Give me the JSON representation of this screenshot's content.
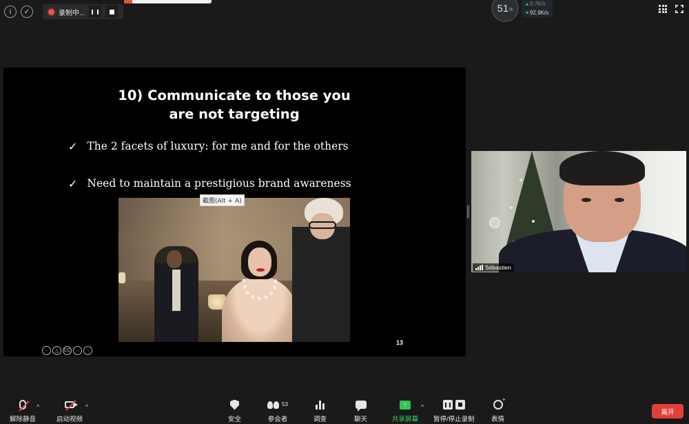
{
  "topbar": {
    "info_icon": "info-icon",
    "security_icon": "shield-check-icon",
    "recording_label": "录制中...",
    "network": {
      "percent": "51",
      "percent_unit": "%",
      "upload": "0.7K/s",
      "download": "92.9K/s"
    }
  },
  "slide": {
    "title_line1": "10) Communicate to those you",
    "title_line2": "are not targeting",
    "bullets": [
      "The 2 facets of luxury: for me and for the others",
      "Need to maintain a prestigious brand awareness"
    ],
    "check_glyph": "✓",
    "page_number": "13",
    "controls": [
      "←",
      "△",
      "CC",
      "⋯",
      "→"
    ]
  },
  "tooltip": {
    "text": "截图(Alt + A)"
  },
  "participant": {
    "name": "Sébastien"
  },
  "toolbar": {
    "mute_label": "解除静音",
    "video_label": "启动视频",
    "security_label": "安全",
    "participants_label": "参会者",
    "participants_count": "53",
    "poll_label": "调查",
    "chat_label": "聊天",
    "share_label": "共享屏幕",
    "record_label": "暂停/停止录制",
    "reactions_label": "表情",
    "leave_label": "离开",
    "caret": "^"
  },
  "colors": {
    "share_green": "#31c45b",
    "leave_red": "#e0403c",
    "lips_red": "#c0232e"
  }
}
